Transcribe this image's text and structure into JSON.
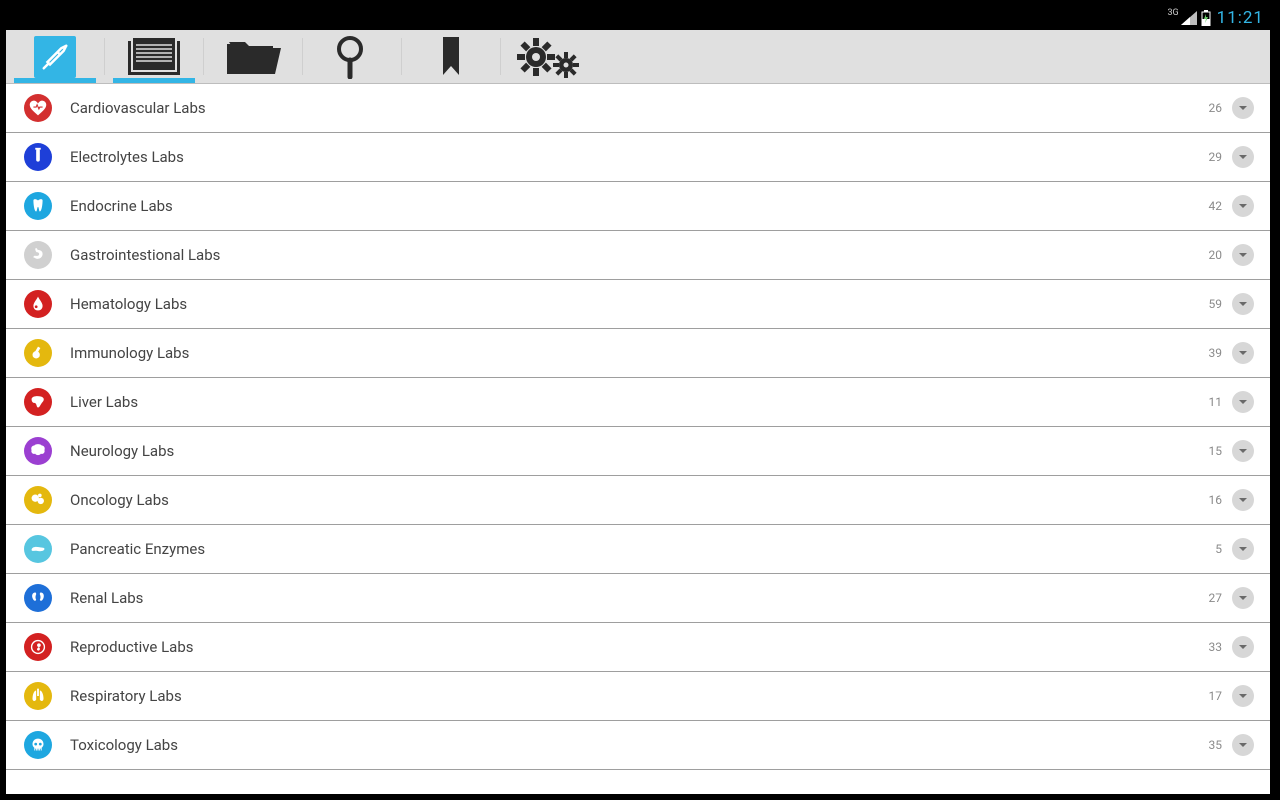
{
  "status": {
    "network_label": "3G",
    "clock": "11:21"
  },
  "toolbar": {
    "tabs": [
      {
        "name": "home",
        "active": true
      },
      {
        "name": "notes",
        "active": true
      },
      {
        "name": "files",
        "active": false
      },
      {
        "name": "search",
        "active": false
      },
      {
        "name": "bookmark",
        "active": false
      },
      {
        "name": "settings",
        "active": false
      }
    ]
  },
  "categories": [
    {
      "label": "Cardiovascular Labs",
      "count": 26,
      "color": "#d32f2f",
      "icon": "heart"
    },
    {
      "label": "Electrolytes Labs",
      "count": 29,
      "color": "#1e3fd8",
      "icon": "tube"
    },
    {
      "label": "Endocrine Labs",
      "count": 42,
      "color": "#1ea7e0",
      "icon": "tooth"
    },
    {
      "label": "Gastrointestional Labs",
      "count": 20,
      "color": "#d0d0d0",
      "icon": "stomach"
    },
    {
      "label": "Hematology Labs",
      "count": 59,
      "color": "#d32121",
      "icon": "drop"
    },
    {
      "label": "Immunology Labs",
      "count": 39,
      "color": "#e4b80e",
      "icon": "scope"
    },
    {
      "label": "Liver Labs",
      "count": 11,
      "color": "#d32121",
      "icon": "liver"
    },
    {
      "label": "Neurology Labs",
      "count": 15,
      "color": "#9b3fd1",
      "icon": "brain"
    },
    {
      "label": "Oncology Labs",
      "count": 16,
      "color": "#e4b80e",
      "icon": "cells"
    },
    {
      "label": "Pancreatic Enzymes",
      "count": 5,
      "color": "#57c6e0",
      "icon": "pancreas"
    },
    {
      "label": "Renal Labs",
      "count": 27,
      "color": "#1e6fd8",
      "icon": "kidneys"
    },
    {
      "label": "Reproductive Labs",
      "count": 33,
      "color": "#d32121",
      "icon": "fetus"
    },
    {
      "label": "Respiratory Labs",
      "count": 17,
      "color": "#e4b80e",
      "icon": "lungs"
    },
    {
      "label": "Toxicology Labs",
      "count": 35,
      "color": "#1ea7e0",
      "icon": "skull"
    }
  ]
}
